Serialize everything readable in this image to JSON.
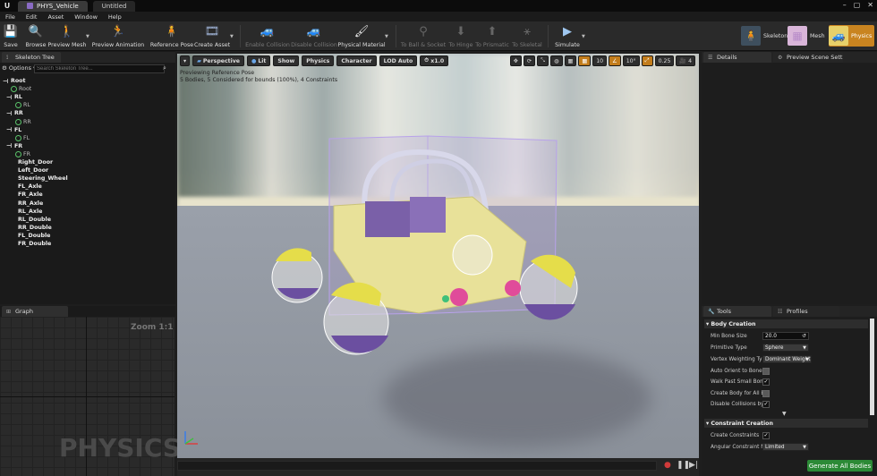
{
  "titlebar": {
    "tabs": [
      {
        "label": "PHYS_Vehicle",
        "active": true
      },
      {
        "label": "Untitled",
        "active": false
      }
    ]
  },
  "menu": [
    "File",
    "Edit",
    "Asset",
    "Window",
    "Help"
  ],
  "toolbar": {
    "save": "Save",
    "browse": "Browse",
    "preview_mesh": "Preview Mesh",
    "preview_animation": "Preview Animation",
    "reference_pose": "Reference Pose",
    "create_asset": "Create Asset",
    "enable_collision": "Enable Collision",
    "disable_collision": "Disable Collision",
    "physical_material": "Physical Material",
    "to_ball_socket": "To Ball & Socket",
    "to_hinge": "To Hinge",
    "to_prismatic": "To Prismatic",
    "to_skeletal": "To Skeletal",
    "simulate": "Simulate",
    "mode_skeleton": "Skeleton",
    "mode_mesh": "Mesh",
    "mode_physics": "Physics"
  },
  "skeleton_tree": {
    "tab": "Skeleton Tree",
    "options": "Options",
    "search_placeholder": "Search Skeleton Tree...",
    "rows": [
      {
        "label": "Root",
        "kind": "bone",
        "bold": true
      },
      {
        "label": "Root",
        "kind": "body"
      },
      {
        "label": "RL",
        "kind": "bone",
        "bold": true
      },
      {
        "label": "RL",
        "kind": "body"
      },
      {
        "label": "RR",
        "kind": "bone",
        "bold": true
      },
      {
        "label": "RR",
        "kind": "body"
      },
      {
        "label": "FL",
        "kind": "bone",
        "bold": true
      },
      {
        "label": "FL",
        "kind": "body"
      },
      {
        "label": "FR",
        "kind": "bone",
        "bold": true
      },
      {
        "label": "FR",
        "kind": "body"
      },
      {
        "label": "Right_Door",
        "kind": "leaf",
        "bold": true
      },
      {
        "label": "Left_Door",
        "kind": "leaf",
        "bold": true
      },
      {
        "label": "Steering_Wheel",
        "kind": "leaf",
        "bold": true
      },
      {
        "label": "FL_Axle",
        "kind": "leaf",
        "bold": true
      },
      {
        "label": "FR_Axle",
        "kind": "leaf",
        "bold": true
      },
      {
        "label": "RR_Axle",
        "kind": "leaf",
        "bold": true
      },
      {
        "label": "RL_Axle",
        "kind": "leaf",
        "bold": true
      },
      {
        "label": "RL_Double",
        "kind": "leaf",
        "bold": true
      },
      {
        "label": "RR_Double",
        "kind": "leaf",
        "bold": true
      },
      {
        "label": "FL_Double",
        "kind": "leaf",
        "bold": true
      },
      {
        "label": "FR_Double",
        "kind": "leaf",
        "bold": true
      }
    ]
  },
  "graph": {
    "tab": "Graph",
    "zoom": "Zoom 1:1",
    "watermark": "PHYSICS"
  },
  "viewport": {
    "perspective": "Perspective",
    "lit": "Lit",
    "show": "Show",
    "physics": "Physics",
    "character": "Character",
    "lod": "LOD Auto",
    "speed": "x1.0",
    "grid_snap": "10",
    "rot_snap": "10°",
    "scale_snap": "0.25",
    "cam_speed": "4",
    "info_line1": "Previewing Reference Pose",
    "info_line2": "5 Bodies, 5 Considered for bounds (100%), 4 Constraints"
  },
  "details": {
    "tab": "Details",
    "tab2": "Preview Scene Sett"
  },
  "tools": {
    "tab": "Tools",
    "tab2": "Profiles",
    "body_creation": "Body Creation",
    "min_bone_size_label": "Min Bone Size",
    "min_bone_size": "20.0",
    "primitive_type_label": "Primitive Type",
    "primitive_type": "Sphere",
    "vertex_weighting_label": "Vertex Weighting Type",
    "vertex_weighting": "Dominant Weight",
    "auto_orient_label": "Auto Orient to Bone",
    "walk_past_label": "Walk Past Small Bone",
    "create_body_all_label": "Create Body for All Bo",
    "disable_collisions_label": "Disable Collisions by I",
    "constraint_creation": "Constraint Creation",
    "create_constraints_label": "Create Constraints",
    "angular_constraint_label": "Angular Constraint Mo",
    "angular_constraint": "Limited",
    "generate_button": "Generate All Bodies",
    "checks": {
      "auto_orient": false,
      "walk_past": true,
      "create_body_all": false,
      "disable_collisions": true,
      "create_constraints": true
    }
  }
}
